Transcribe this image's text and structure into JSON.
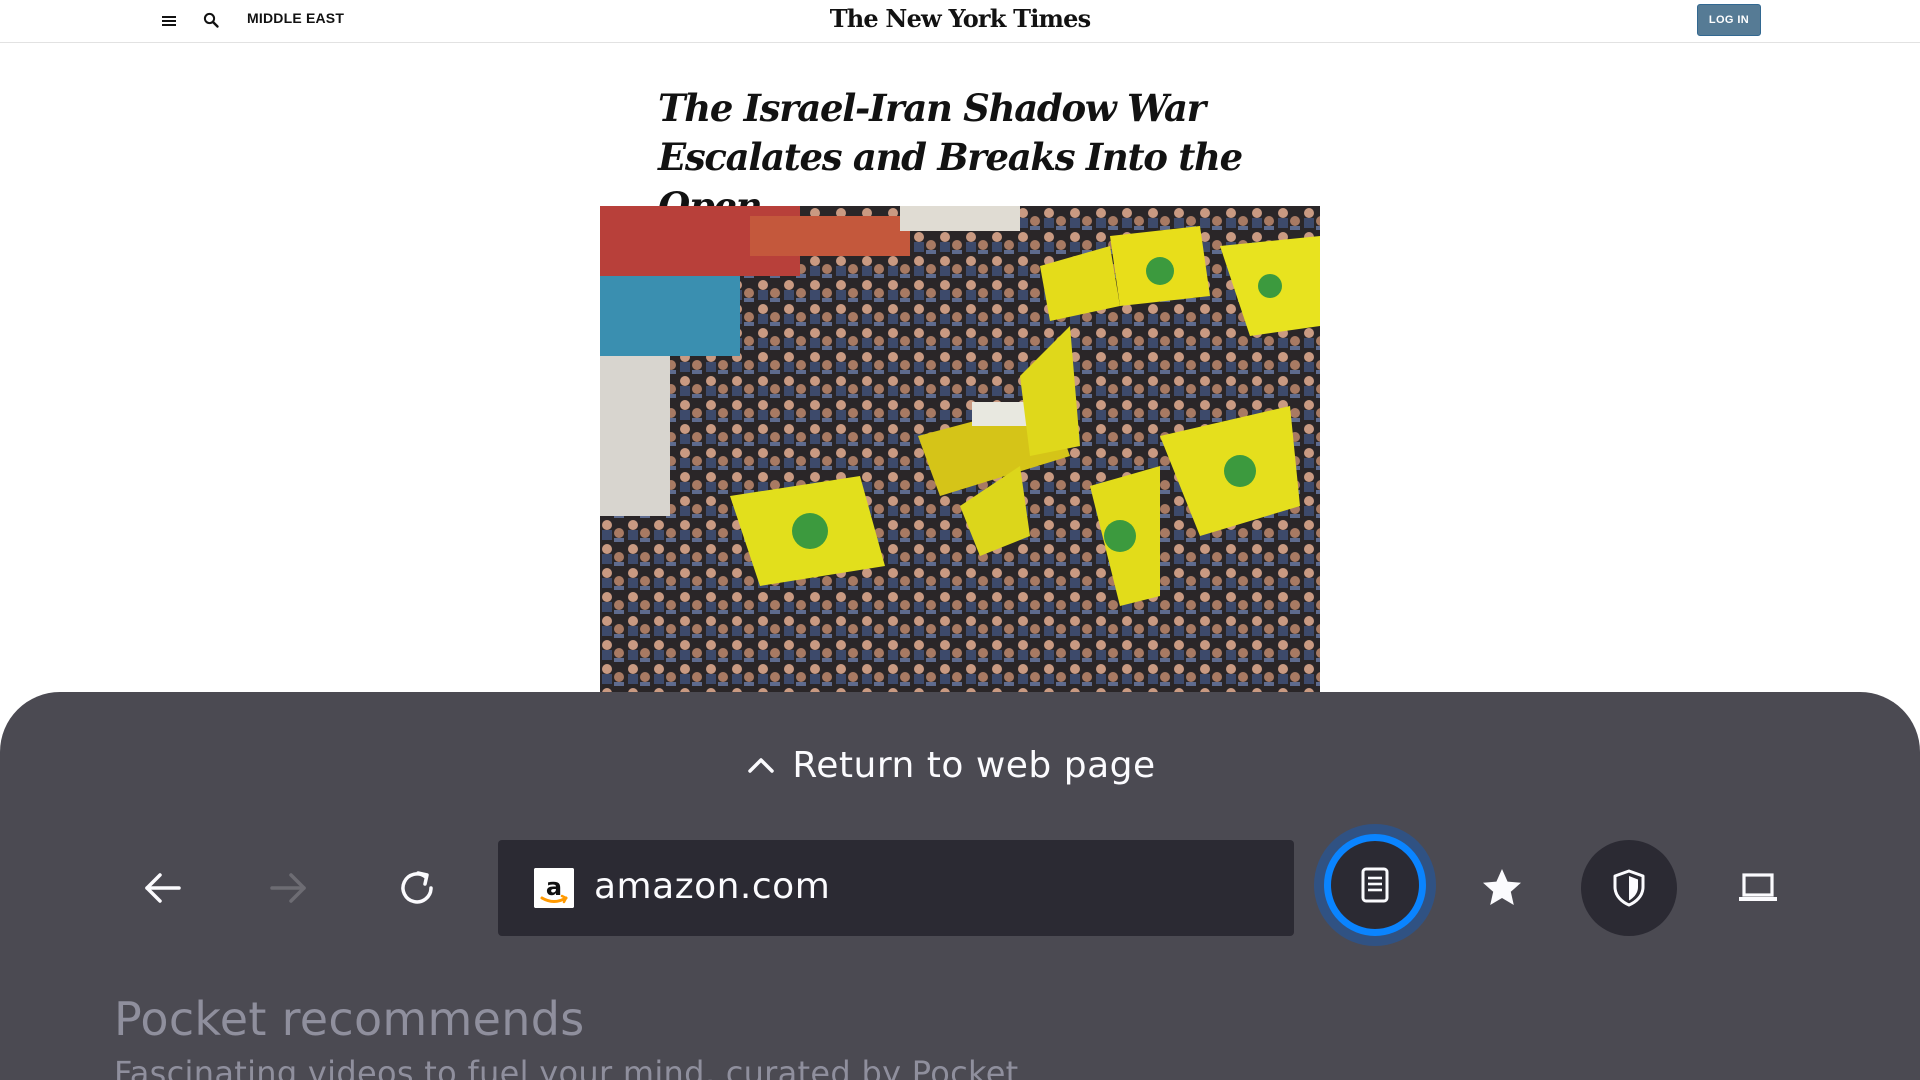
{
  "nyt": {
    "section": "MIDDLE EAST",
    "logo": "The New York Times",
    "login_label": "LOG IN",
    "icons": {
      "menu": "hamburger-menu-icon",
      "search": "search-icon"
    }
  },
  "article": {
    "headline_line1": "The Israel-Iran Shadow War",
    "headline_line2": "Escalates and Breaks Into the Open",
    "image": "crowd-with-yellow-flags-photo"
  },
  "toolbar": {
    "return_label": "Return to web page",
    "url": "amazon.com",
    "buttons": {
      "back": "back-arrow-icon",
      "forward": "forward-arrow-icon",
      "reload": "reload-icon",
      "reader": "reader-view-icon",
      "bookmark": "star-icon",
      "tracking": "shield-icon",
      "desktop": "desktop-mode-icon"
    },
    "colors": {
      "sheet": "#4b4a52",
      "field": "#2b2a33",
      "focus_ring": "#0a84ff",
      "text": "#fbfbfe",
      "disabled": "#6d6c73"
    }
  },
  "pocket": {
    "title": "Pocket recommends",
    "subtitle": "Fascinating videos to fuel your mind, curated by Pocket"
  }
}
